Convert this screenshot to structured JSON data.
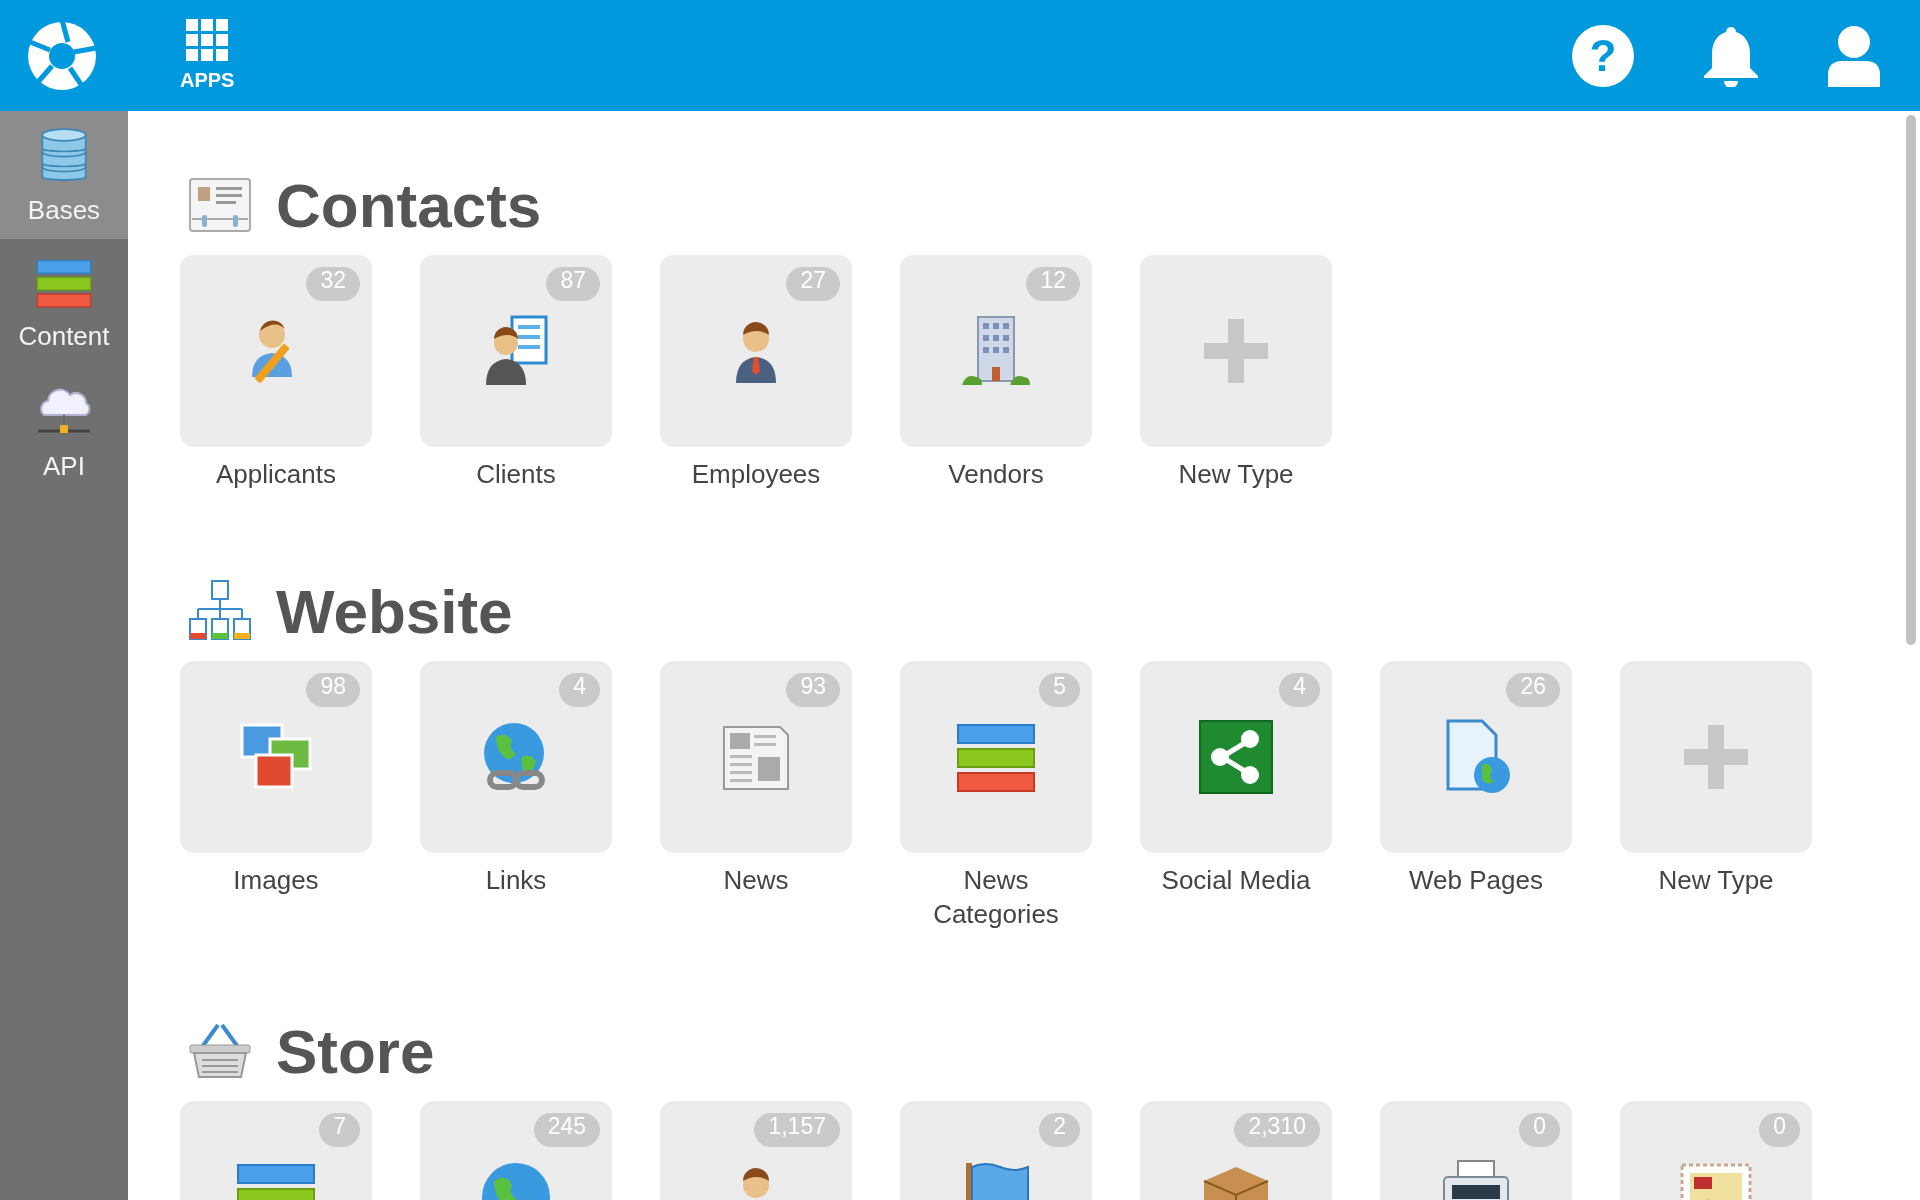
{
  "topbar": {
    "apps_label": "APPS",
    "help_label": "?"
  },
  "sidebar": {
    "items": [
      {
        "label": "Bases",
        "selected": true
      },
      {
        "label": "Content",
        "selected": false
      },
      {
        "label": "API",
        "selected": false
      }
    ]
  },
  "sections": [
    {
      "title": "Contacts",
      "tiles": [
        {
          "kind": "type",
          "label": "Applicants",
          "count": "32"
        },
        {
          "kind": "type",
          "label": "Clients",
          "count": "87"
        },
        {
          "kind": "type",
          "label": "Employees",
          "count": "27"
        },
        {
          "kind": "type",
          "label": "Vendors",
          "count": "12"
        },
        {
          "kind": "new",
          "label": "New Type"
        }
      ]
    },
    {
      "title": "Website",
      "tiles": [
        {
          "kind": "type",
          "label": "Images",
          "count": "98"
        },
        {
          "kind": "type",
          "label": "Links",
          "count": "4"
        },
        {
          "kind": "type",
          "label": "News",
          "count": "93"
        },
        {
          "kind": "type",
          "label": "News Categories",
          "count": "5"
        },
        {
          "kind": "type",
          "label": "Social Media",
          "count": "4"
        },
        {
          "kind": "type",
          "label": "Web Pages",
          "count": "26"
        },
        {
          "kind": "new",
          "label": "New Type"
        }
      ]
    },
    {
      "title": "Store",
      "tiles": [
        {
          "kind": "type",
          "count": "7"
        },
        {
          "kind": "type",
          "count": "245"
        },
        {
          "kind": "type",
          "count": "1,157"
        },
        {
          "kind": "type",
          "count": "2"
        },
        {
          "kind": "type",
          "count": "2,310"
        },
        {
          "kind": "type",
          "count": "0"
        },
        {
          "kind": "type",
          "count": "0"
        }
      ]
    }
  ]
}
